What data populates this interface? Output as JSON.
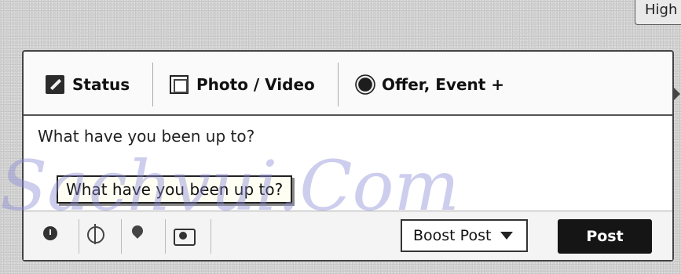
{
  "top_button": {
    "label": "High"
  },
  "composer": {
    "tabs": [
      {
        "label": "Status",
        "icon": "pencil-icon"
      },
      {
        "label": "Photo / Video",
        "icon": "photo-icon"
      },
      {
        "label": "Offer, Event +",
        "icon": "burst-icon"
      }
    ],
    "placeholder": "What have you been up to?",
    "tooltip": "What have you been up to?",
    "toolbar": {
      "icons": [
        "clock-icon",
        "target-icon",
        "location-pin-icon",
        "camera-icon"
      ],
      "boost_label": "Boost Post",
      "post_label": "Post"
    }
  },
  "watermark": "Sachvui.Com"
}
